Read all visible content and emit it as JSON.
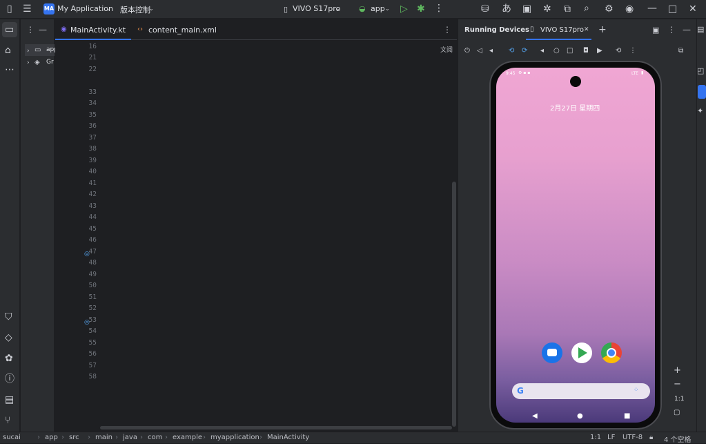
{
  "titlebar": {
    "project_badge": "MA",
    "project_name": "My Application",
    "vcs_label": "版本控制",
    "device_name": "VIVO S17pro",
    "run_config": "app"
  },
  "tabs": [
    {
      "label": "MainActivity.kt"
    },
    {
      "label": "content_main.xml"
    }
  ],
  "project_tree": {
    "item1": "app",
    "item2": "Gr"
  },
  "editor": {
    "reader_mode": "文阅",
    "line_numbers": [
      "16",
      "21",
      "22",
      "33",
      "34",
      "35",
      "36",
      "37",
      "38",
      "39",
      "40",
      "41",
      "42",
      "43",
      "44",
      "45",
      "46",
      "47",
      "48",
      "49",
      "50",
      "51",
      "52",
      "53",
      "54",
      "55",
      "56",
      "57",
      "58"
    ]
  },
  "right_panel": {
    "title": "Running Devices",
    "device_tab": "VIVO S17pro",
    "zoom_label": "1:1"
  },
  "phone": {
    "clock": "9:45",
    "network": "LTE",
    "date_text": "2月27日 星期四",
    "search_logo": "G"
  },
  "statusbar": {
    "breadcrumb": [
      "sucai",
      "app",
      "src",
      "main",
      "java",
      "com",
      "example",
      "myapplication",
      "MainActivity"
    ],
    "position": "1:1",
    "line_sep": "LF",
    "encoding": "UTF-8",
    "indent": "4 个空格"
  },
  "colors": {
    "accent": "#3574f0",
    "background": "#1e1f22",
    "panel": "#2b2d30"
  }
}
